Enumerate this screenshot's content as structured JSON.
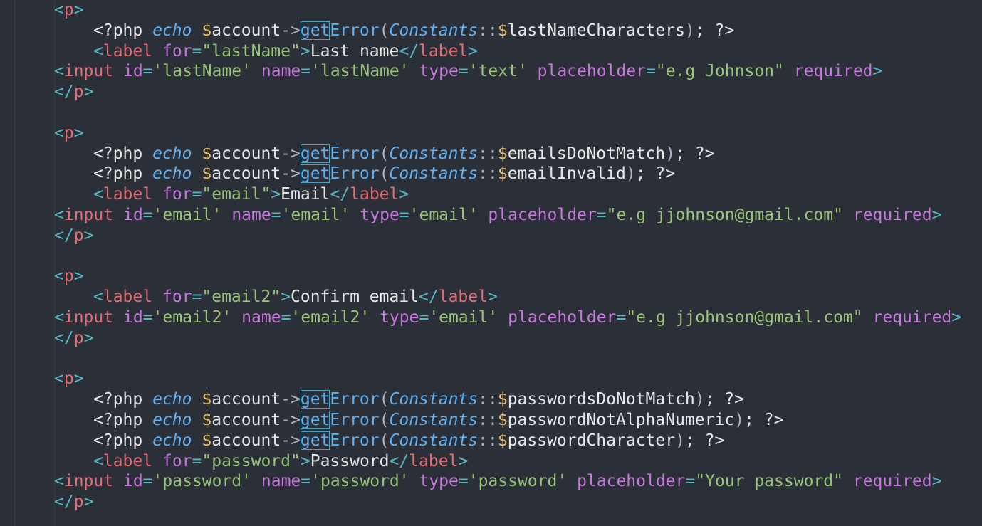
{
  "colors": {
    "background": "#2b2f37",
    "tag": "#e06c75",
    "punctuation": "#56b6c2",
    "attribute": "#c678dd",
    "string": "#98c379",
    "keyword": "#61afef",
    "variable": "#e5c07b",
    "plain": "#e6e6e6"
  },
  "code": {
    "lines": [
      {
        "indent": 1,
        "tokens": [
          [
            "punc",
            "<"
          ],
          [
            "tag",
            "p"
          ],
          [
            "punc",
            ">"
          ]
        ]
      },
      {
        "indent": 2,
        "tokens": [
          [
            "plain",
            "<?php "
          ],
          [
            "kw",
            "echo"
          ],
          [
            "plain",
            " "
          ],
          [
            "var",
            "$"
          ],
          [
            "plain",
            "account"
          ],
          [
            "op",
            "->"
          ],
          [
            "hl",
            "get"
          ],
          [
            "fn",
            "Error"
          ],
          [
            "op",
            "("
          ],
          [
            "cls",
            "Constants"
          ],
          [
            "op",
            "::"
          ],
          [
            "var",
            "$"
          ],
          [
            "plain",
            "lastNameCharacters"
          ],
          [
            "op",
            ")"
          ],
          [
            "plain",
            "; "
          ],
          [
            "plain",
            "?>"
          ]
        ]
      },
      {
        "indent": 2,
        "tokens": [
          [
            "punc",
            "<"
          ],
          [
            "tag",
            "label"
          ],
          [
            "plain",
            " "
          ],
          [
            "attr",
            "for"
          ],
          [
            "punc",
            "="
          ],
          [
            "str",
            "\"lastName\""
          ],
          [
            "punc",
            ">"
          ],
          [
            "plain",
            "Last name"
          ],
          [
            "punc",
            "</"
          ],
          [
            "tag",
            "label"
          ],
          [
            "punc",
            ">"
          ]
        ]
      },
      {
        "indent": 1,
        "tokens": [
          [
            "punc",
            "<"
          ],
          [
            "tag",
            "input"
          ],
          [
            "plain",
            " "
          ],
          [
            "attr",
            "id"
          ],
          [
            "punc",
            "="
          ],
          [
            "str",
            "'lastName'"
          ],
          [
            "plain",
            " "
          ],
          [
            "attr",
            "name"
          ],
          [
            "punc",
            "="
          ],
          [
            "str",
            "'lastName'"
          ],
          [
            "plain",
            " "
          ],
          [
            "attr",
            "type"
          ],
          [
            "punc",
            "="
          ],
          [
            "str",
            "'text'"
          ],
          [
            "plain",
            " "
          ],
          [
            "attr",
            "placeholder"
          ],
          [
            "punc",
            "="
          ],
          [
            "str",
            "\"e.g Johnson\""
          ],
          [
            "plain",
            " "
          ],
          [
            "attr",
            "required"
          ],
          [
            "punc",
            ">"
          ]
        ]
      },
      {
        "indent": 1,
        "tokens": [
          [
            "punc",
            "</"
          ],
          [
            "tag",
            "p"
          ],
          [
            "punc",
            ">"
          ]
        ]
      },
      {
        "indent": 0,
        "tokens": []
      },
      {
        "indent": 1,
        "tokens": [
          [
            "punc",
            "<"
          ],
          [
            "tag",
            "p"
          ],
          [
            "punc",
            ">"
          ]
        ]
      },
      {
        "indent": 2,
        "tokens": [
          [
            "plain",
            "<?php "
          ],
          [
            "kw",
            "echo"
          ],
          [
            "plain",
            " "
          ],
          [
            "var",
            "$"
          ],
          [
            "plain",
            "account"
          ],
          [
            "op",
            "->"
          ],
          [
            "hl",
            "get"
          ],
          [
            "fn",
            "Error"
          ],
          [
            "op",
            "("
          ],
          [
            "cls",
            "Constants"
          ],
          [
            "op",
            "::"
          ],
          [
            "var",
            "$"
          ],
          [
            "plain",
            "emailsDoNotMatch"
          ],
          [
            "op",
            ")"
          ],
          [
            "plain",
            "; "
          ],
          [
            "plain",
            "?>"
          ]
        ]
      },
      {
        "indent": 2,
        "tokens": [
          [
            "plain",
            "<?php "
          ],
          [
            "kw",
            "echo"
          ],
          [
            "plain",
            " "
          ],
          [
            "var",
            "$"
          ],
          [
            "plain",
            "account"
          ],
          [
            "op",
            "->"
          ],
          [
            "hl",
            "get"
          ],
          [
            "fn",
            "Error"
          ],
          [
            "op",
            "("
          ],
          [
            "cls",
            "Constants"
          ],
          [
            "op",
            "::"
          ],
          [
            "var",
            "$"
          ],
          [
            "plain",
            "emailInvalid"
          ],
          [
            "op",
            ")"
          ],
          [
            "plain",
            "; "
          ],
          [
            "plain",
            "?>"
          ]
        ]
      },
      {
        "indent": 2,
        "tokens": [
          [
            "punc",
            "<"
          ],
          [
            "tag",
            "label"
          ],
          [
            "plain",
            " "
          ],
          [
            "attr",
            "for"
          ],
          [
            "punc",
            "="
          ],
          [
            "str",
            "\"email\""
          ],
          [
            "punc",
            ">"
          ],
          [
            "plain",
            "Email"
          ],
          [
            "punc",
            "</"
          ],
          [
            "tag",
            "label"
          ],
          [
            "punc",
            ">"
          ]
        ]
      },
      {
        "indent": 1,
        "tokens": [
          [
            "punc",
            "<"
          ],
          [
            "tag",
            "input"
          ],
          [
            "plain",
            " "
          ],
          [
            "attr",
            "id"
          ],
          [
            "punc",
            "="
          ],
          [
            "str",
            "'email'"
          ],
          [
            "plain",
            " "
          ],
          [
            "attr",
            "name"
          ],
          [
            "punc",
            "="
          ],
          [
            "str",
            "'email'"
          ],
          [
            "plain",
            " "
          ],
          [
            "attr",
            "type"
          ],
          [
            "punc",
            "="
          ],
          [
            "str",
            "'email'"
          ],
          [
            "plain",
            " "
          ],
          [
            "attr",
            "placeholder"
          ],
          [
            "punc",
            "="
          ],
          [
            "str",
            "\"e.g jjohnson@gmail.com\""
          ],
          [
            "plain",
            " "
          ],
          [
            "attr",
            "required"
          ],
          [
            "punc",
            ">"
          ]
        ]
      },
      {
        "indent": 1,
        "tokens": [
          [
            "punc",
            "</"
          ],
          [
            "tag",
            "p"
          ],
          [
            "punc",
            ">"
          ]
        ]
      },
      {
        "indent": 0,
        "tokens": []
      },
      {
        "indent": 1,
        "tokens": [
          [
            "punc",
            "<"
          ],
          [
            "tag",
            "p"
          ],
          [
            "punc",
            ">"
          ]
        ]
      },
      {
        "indent": 2,
        "tokens": [
          [
            "punc",
            "<"
          ],
          [
            "tag",
            "label"
          ],
          [
            "plain",
            " "
          ],
          [
            "attr",
            "for"
          ],
          [
            "punc",
            "="
          ],
          [
            "str",
            "\"email2\""
          ],
          [
            "punc",
            ">"
          ],
          [
            "plain",
            "Confirm email"
          ],
          [
            "punc",
            "</"
          ],
          [
            "tag",
            "label"
          ],
          [
            "punc",
            ">"
          ]
        ]
      },
      {
        "indent": 1,
        "tokens": [
          [
            "punc",
            "<"
          ],
          [
            "tag",
            "input"
          ],
          [
            "plain",
            " "
          ],
          [
            "attr",
            "id"
          ],
          [
            "punc",
            "="
          ],
          [
            "str",
            "'email2'"
          ],
          [
            "plain",
            " "
          ],
          [
            "attr",
            "name"
          ],
          [
            "punc",
            "="
          ],
          [
            "str",
            "'email2'"
          ],
          [
            "plain",
            " "
          ],
          [
            "attr",
            "type"
          ],
          [
            "punc",
            "="
          ],
          [
            "str",
            "'email'"
          ],
          [
            "plain",
            " "
          ],
          [
            "attr",
            "placeholder"
          ],
          [
            "punc",
            "="
          ],
          [
            "str",
            "\"e.g jjohnson@gmail.com\""
          ],
          [
            "plain",
            " "
          ],
          [
            "attr",
            "required"
          ],
          [
            "punc",
            ">"
          ]
        ]
      },
      {
        "indent": 1,
        "tokens": [
          [
            "punc",
            "</"
          ],
          [
            "tag",
            "p"
          ],
          [
            "punc",
            ">"
          ]
        ]
      },
      {
        "indent": 0,
        "tokens": []
      },
      {
        "indent": 1,
        "tokens": [
          [
            "punc",
            "<"
          ],
          [
            "tag",
            "p"
          ],
          [
            "punc",
            ">"
          ]
        ]
      },
      {
        "indent": 2,
        "tokens": [
          [
            "plain",
            "<?php "
          ],
          [
            "kw",
            "echo"
          ],
          [
            "plain",
            " "
          ],
          [
            "var",
            "$"
          ],
          [
            "plain",
            "account"
          ],
          [
            "op",
            "->"
          ],
          [
            "hl",
            "get"
          ],
          [
            "fn",
            "Error"
          ],
          [
            "op",
            "("
          ],
          [
            "cls",
            "Constants"
          ],
          [
            "op",
            "::"
          ],
          [
            "var",
            "$"
          ],
          [
            "plain",
            "passwordsDoNotMatch"
          ],
          [
            "op",
            ")"
          ],
          [
            "plain",
            "; "
          ],
          [
            "plain",
            "?>"
          ]
        ]
      },
      {
        "indent": 2,
        "tokens": [
          [
            "plain",
            "<?php "
          ],
          [
            "kw",
            "echo"
          ],
          [
            "plain",
            " "
          ],
          [
            "var",
            "$"
          ],
          [
            "plain",
            "account"
          ],
          [
            "op",
            "->"
          ],
          [
            "hl",
            "get"
          ],
          [
            "fn",
            "Error"
          ],
          [
            "op",
            "("
          ],
          [
            "cls",
            "Constants"
          ],
          [
            "op",
            "::"
          ],
          [
            "var",
            "$"
          ],
          [
            "plain",
            "passwordNotAlphaNumeric"
          ],
          [
            "op",
            ")"
          ],
          [
            "plain",
            "; "
          ],
          [
            "plain",
            "?>"
          ]
        ]
      },
      {
        "indent": 2,
        "tokens": [
          [
            "plain",
            "<?php "
          ],
          [
            "kw",
            "echo"
          ],
          [
            "plain",
            " "
          ],
          [
            "var",
            "$"
          ],
          [
            "plain",
            "account"
          ],
          [
            "op",
            "->"
          ],
          [
            "hl",
            "get"
          ],
          [
            "fn",
            "Error"
          ],
          [
            "op",
            "("
          ],
          [
            "cls",
            "Constants"
          ],
          [
            "op",
            "::"
          ],
          [
            "var",
            "$"
          ],
          [
            "plain",
            "passwordCharacter"
          ],
          [
            "op",
            ")"
          ],
          [
            "plain",
            "; "
          ],
          [
            "plain",
            "?>"
          ]
        ]
      },
      {
        "indent": 2,
        "tokens": [
          [
            "punc",
            "<"
          ],
          [
            "tag",
            "label"
          ],
          [
            "plain",
            " "
          ],
          [
            "attr",
            "for"
          ],
          [
            "punc",
            "="
          ],
          [
            "str",
            "\"password\""
          ],
          [
            "punc",
            ">"
          ],
          [
            "plain",
            "Password"
          ],
          [
            "punc",
            "</"
          ],
          [
            "tag",
            "label"
          ],
          [
            "punc",
            ">"
          ]
        ]
      },
      {
        "indent": 1,
        "tokens": [
          [
            "punc",
            "<"
          ],
          [
            "tag",
            "input"
          ],
          [
            "plain",
            " "
          ],
          [
            "attr",
            "id"
          ],
          [
            "punc",
            "="
          ],
          [
            "str",
            "'password'"
          ],
          [
            "plain",
            " "
          ],
          [
            "attr",
            "name"
          ],
          [
            "punc",
            "="
          ],
          [
            "str",
            "'password'"
          ],
          [
            "plain",
            " "
          ],
          [
            "attr",
            "type"
          ],
          [
            "punc",
            "="
          ],
          [
            "str",
            "'password'"
          ],
          [
            "plain",
            " "
          ],
          [
            "attr",
            "placeholder"
          ],
          [
            "punc",
            "="
          ],
          [
            "str",
            "\"Your password\""
          ],
          [
            "plain",
            " "
          ],
          [
            "attr",
            "required"
          ],
          [
            "punc",
            ">"
          ]
        ]
      },
      {
        "indent": 1,
        "tokens": [
          [
            "punc",
            "</"
          ],
          [
            "tag",
            "p"
          ],
          [
            "punc",
            ">"
          ]
        ]
      }
    ]
  }
}
